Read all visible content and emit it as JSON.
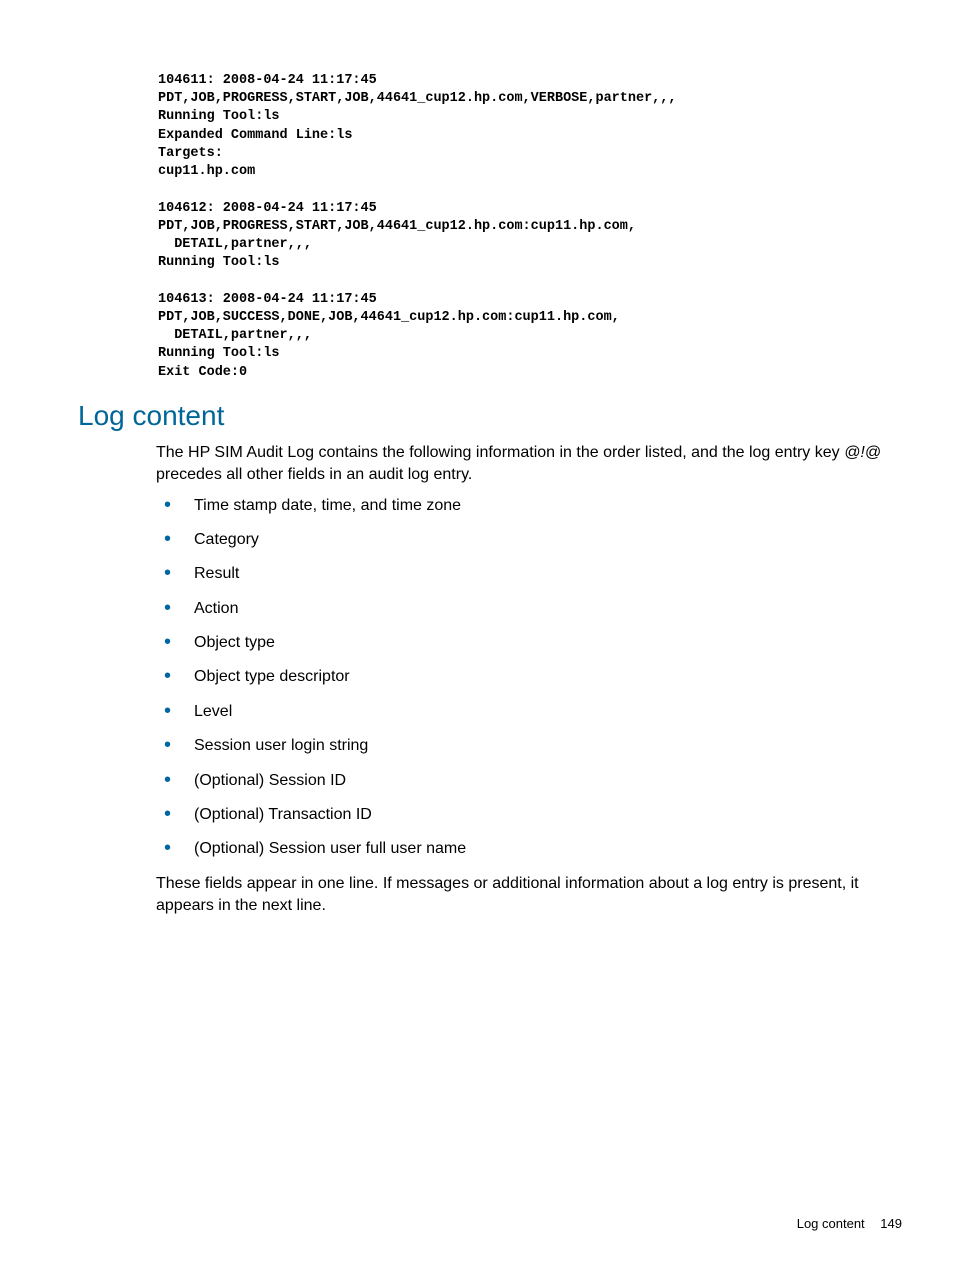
{
  "code_block": "104611: 2008-04-24 11:17:45\nPDT,JOB,PROGRESS,START,JOB,44641_cup12.hp.com,VERBOSE,partner,,,\nRunning Tool:ls\nExpanded Command Line:ls\nTargets:\ncup11.hp.com\n\n104612: 2008-04-24 11:17:45\nPDT,JOB,PROGRESS,START,JOB,44641_cup12.hp.com:cup11.hp.com,\n  DETAIL,partner,,,\nRunning Tool:ls\n\n104613: 2008-04-24 11:17:45\nPDT,JOB,SUCCESS,DONE,JOB,44641_cup12.hp.com:cup11.hp.com,\n  DETAIL,partner,,,\nRunning Tool:ls\nExit Code:0",
  "heading": "Log content",
  "intro_part1": "The HP SIM Audit Log contains the following information in the order listed, and the log entry key ",
  "intro_key": "@!@",
  "intro_part2": " precedes all other fields in an audit log entry.",
  "bullets": [
    "Time stamp date, time, and time zone",
    "Category",
    "Result",
    "Action",
    "Object type",
    "Object type descriptor",
    "Level",
    "Session user login string",
    "(Optional) Session ID",
    "(Optional) Transaction ID",
    "(Optional) Session user full user name"
  ],
  "closing": "These fields appear in one line. If messages or additional information about a log entry is present, it appears in the next line.",
  "footer_label": "Log content",
  "footer_page": "149"
}
